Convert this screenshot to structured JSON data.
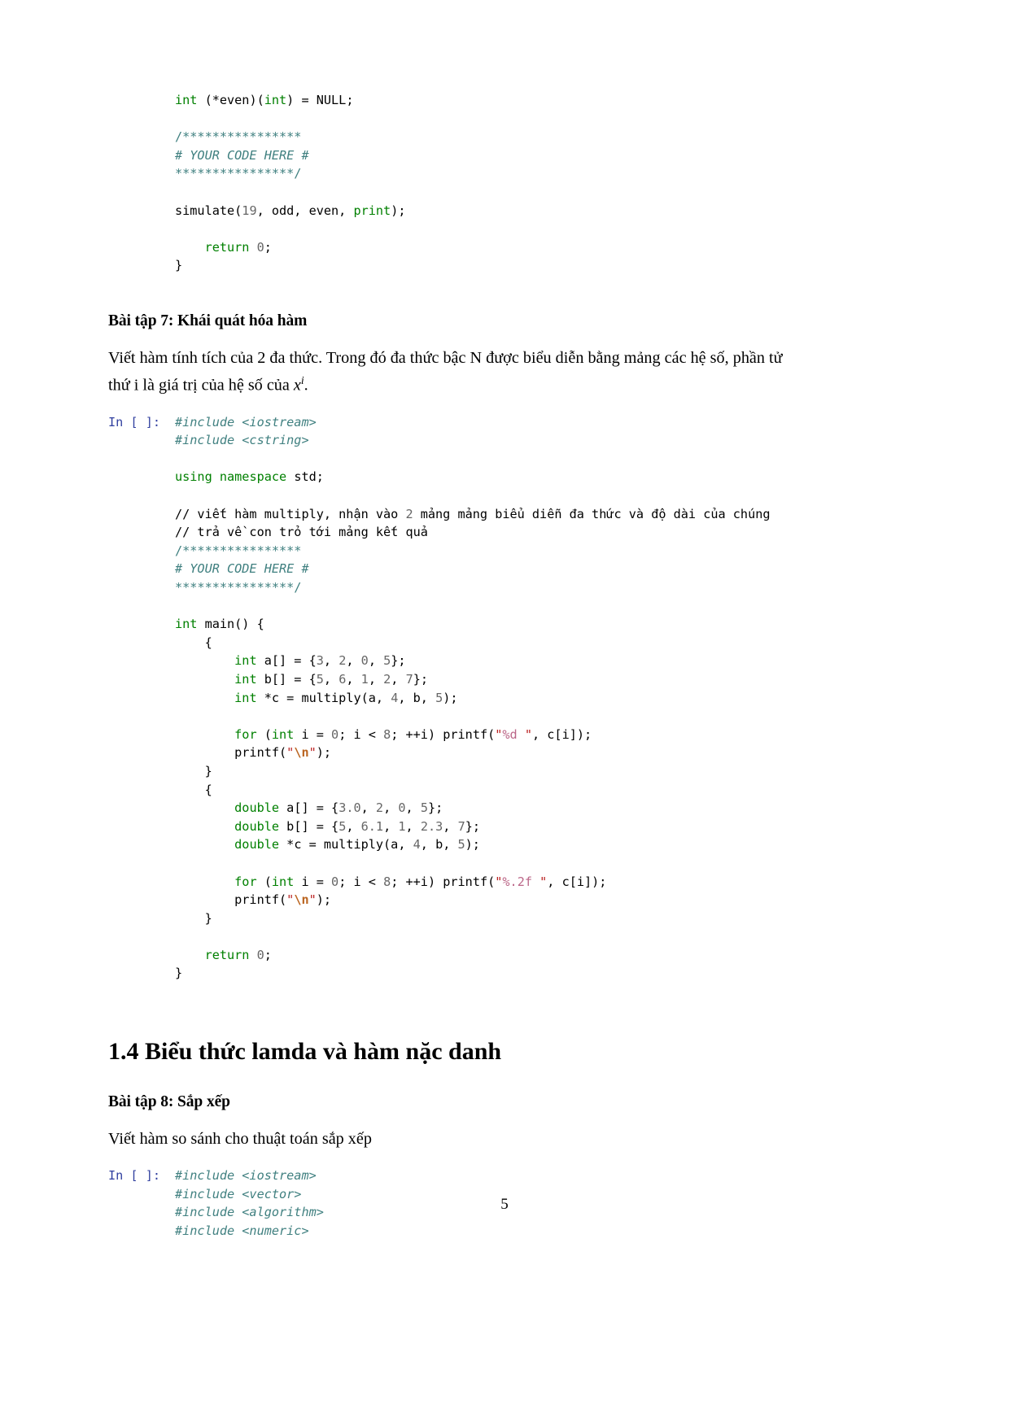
{
  "page": {
    "number": "5"
  },
  "block_top_code": {
    "prompt": "",
    "lines": [
      {
        "id": "l1",
        "text": "int (*even)(int) = NULL;"
      },
      {
        "id": "l2",
        "text": ""
      },
      {
        "id": "l3",
        "text": "/****************"
      },
      {
        "id": "l4",
        "text": "# YOUR CODE HERE #"
      },
      {
        "id": "l5",
        "text": "****************/"
      },
      {
        "id": "l6",
        "text": ""
      },
      {
        "id": "l7",
        "text": "simulate(19, odd, even, print);"
      },
      {
        "id": "l8",
        "text": ""
      },
      {
        "id": "l9",
        "text": "    return 0;"
      },
      {
        "id": "l10",
        "text": "}"
      }
    ]
  },
  "exercise7": {
    "heading": "Bài tập 7: Khái quát hóa hàm",
    "paragraph_line1": "Viết hàm tính tích của 2 đa thức. Trong đó đa thức bậc N được biểu diễn bằng mảng các hệ số, phần tử",
    "paragraph_line2_pre": "thứ i là giá trị của hệ số của ",
    "paragraph_line2_var": "x",
    "paragraph_line2_sup": "i",
    "paragraph_line2_post": ".",
    "prompt": "In [ ]:",
    "lines": [
      {
        "id": "c1",
        "text": "#include <iostream>"
      },
      {
        "id": "c2",
        "text": "#include <cstring>"
      },
      {
        "id": "c3",
        "text": ""
      },
      {
        "id": "c4",
        "text": "using namespace std;"
      },
      {
        "id": "c5",
        "text": ""
      },
      {
        "id": "c6",
        "text": "// viết hàm multiply, nhận vào 2 mảng mảng biểu diễn đa thức và độ dài của chúng"
      },
      {
        "id": "c7",
        "text": "// trả về con trỏ tới mảng kết quả"
      },
      {
        "id": "c8",
        "text": "/****************"
      },
      {
        "id": "c9",
        "text": "# YOUR CODE HERE #"
      },
      {
        "id": "c10",
        "text": "****************/"
      },
      {
        "id": "c11",
        "text": ""
      },
      {
        "id": "c12",
        "text": "int main() {"
      },
      {
        "id": "c13",
        "text": "    {"
      },
      {
        "id": "c14",
        "text": "        int a[] = {3, 2, 0, 5};"
      },
      {
        "id": "c15",
        "text": "        int b[] = {5, 6, 1, 2, 7};"
      },
      {
        "id": "c16",
        "text": "        int *c = multiply(a, 4, b, 5);"
      },
      {
        "id": "c17",
        "text": ""
      },
      {
        "id": "c18",
        "text": "        for (int i = 0; i < 8; ++i) printf(\"%d \", c[i]);"
      },
      {
        "id": "c19",
        "text": "        printf(\"\\n\");"
      },
      {
        "id": "c20",
        "text": "    }"
      },
      {
        "id": "c21",
        "text": "    {"
      },
      {
        "id": "c22",
        "text": "        double a[] = {3.0, 2, 0, 5};"
      },
      {
        "id": "c23",
        "text": "        double b[] = {5, 6.1, 1, 2.3, 7};"
      },
      {
        "id": "c24",
        "text": "        double *c = multiply(a, 4, b, 5);"
      },
      {
        "id": "c25",
        "text": ""
      },
      {
        "id": "c26",
        "text": "        for (int i = 0; i < 8; ++i) printf(\"%.2f \", c[i]);"
      },
      {
        "id": "c27",
        "text": "        printf(\"\\n\");"
      },
      {
        "id": "c28",
        "text": "    }"
      },
      {
        "id": "c29",
        "text": ""
      },
      {
        "id": "c30",
        "text": "    return 0;"
      },
      {
        "id": "c31",
        "text": "}"
      }
    ]
  },
  "section14": {
    "heading": "1.4 Biểu thức lamda và hàm nặc danh"
  },
  "exercise8": {
    "heading": "Bài tập 8: Sắp xếp",
    "paragraph": "Viết hàm so sánh cho thuật toán sắp xếp",
    "prompt": "In [ ]:",
    "lines": [
      {
        "id": "d1",
        "text": "#include <iostream>"
      },
      {
        "id": "d2",
        "text": "#include <vector>"
      },
      {
        "id": "d3",
        "text": "#include <algorithm>"
      },
      {
        "id": "d4",
        "text": "#include <numeric>"
      }
    ]
  },
  "colors": {
    "keyword": "#008000",
    "number": "#666666",
    "string": "#ba2121",
    "escape": "#bb6622",
    "comment": "#408080",
    "prompt": "#303f9f",
    "text": "#000000"
  }
}
